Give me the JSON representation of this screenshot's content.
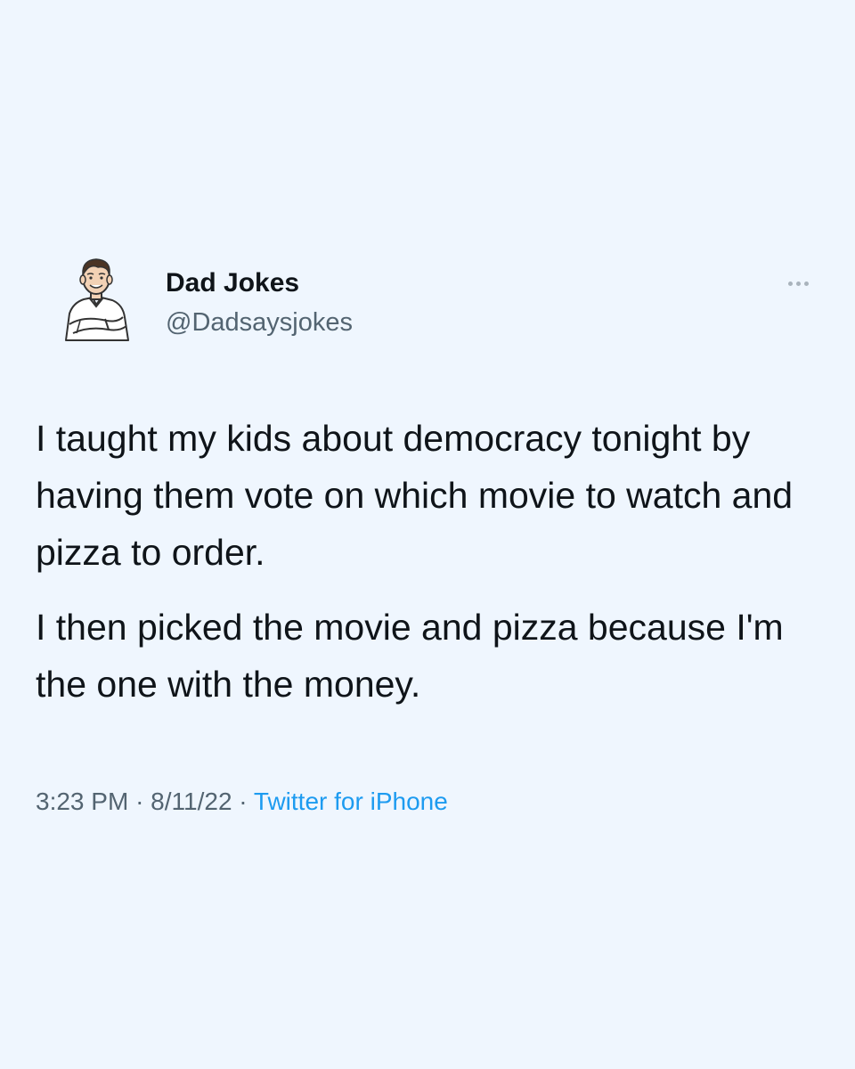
{
  "tweet": {
    "author": {
      "display_name": "Dad Jokes",
      "handle": "@Dadsaysjokes",
      "avatar_icon": "cartoon-dad-avatar-icon"
    },
    "more_icon": "more-options-icon",
    "paragraphs": [
      "I taught my kids about democracy tonight by having them vote on which movie to watch and pizza to order.",
      "I then picked the movie and pizza because I'm the one with the money."
    ],
    "time": "3:23 PM",
    "separator": "·",
    "date": "8/11/22",
    "source": "Twitter for iPhone"
  },
  "colors": {
    "background": "#eff6fe",
    "text": "#0f1419",
    "secondary_text": "#536471",
    "link": "#1d9bf0"
  }
}
